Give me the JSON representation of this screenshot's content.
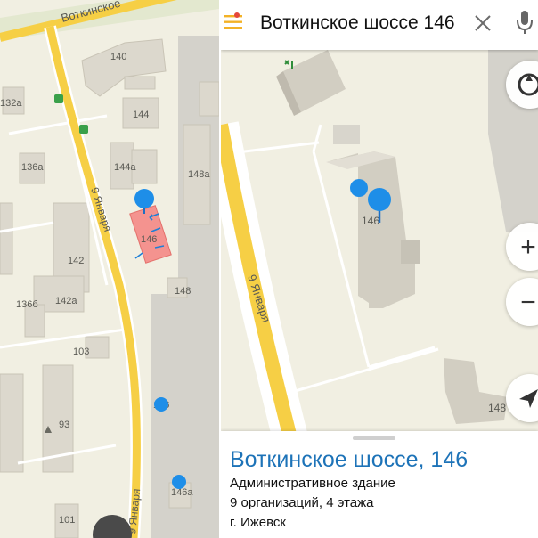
{
  "left_map": {
    "street_labels": {
      "votkinskoe": "Воткинское",
      "yanvarya_upper": "9 Января",
      "yanvarya_lower": "9 Января"
    },
    "building_labels": [
      "140",
      "132а",
      "144",
      "144а",
      "136а",
      "148а",
      "146",
      "142",
      "142а",
      "136б",
      "148",
      "103",
      "93",
      "146",
      "146а",
      "101"
    ]
  },
  "right_map": {
    "street_label": "9 Января",
    "building_labels": [
      "146",
      "148"
    ]
  },
  "search": {
    "query": "Воткинское шоссе 146"
  },
  "controls": {
    "zoom_in": "+",
    "zoom_out": "−"
  },
  "info_card": {
    "title": "Воткинское шоссе, 146",
    "type": "Административное здание",
    "details": "9 организаций, 4 этажа",
    "city": "г. Ижевск"
  },
  "colors": {
    "road_yellow": "#f6cf45",
    "accent_blue": "#1d73b8",
    "pin_blue": "#1e8ee8",
    "highlight_building": "#f4938f",
    "building": "#dcd8cd"
  },
  "icons": [
    "menu-icon",
    "clear-icon",
    "mic-icon",
    "compass-icon",
    "location-arrow-icon",
    "bus-stop-icon",
    "service-icon"
  ]
}
